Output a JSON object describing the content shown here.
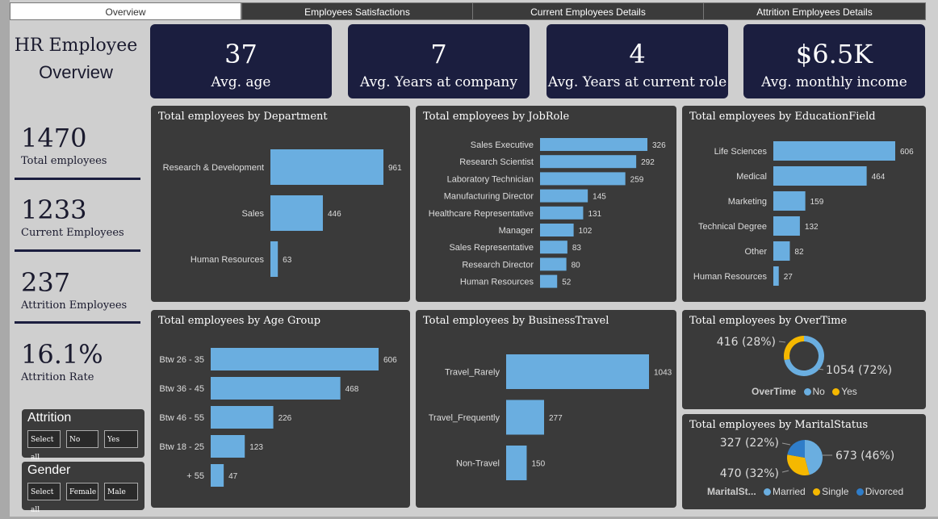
{
  "tabs": [
    {
      "label": "Overview",
      "active": true
    },
    {
      "label": "Employees Satisfactions",
      "active": false
    },
    {
      "label": "Current Employees Details",
      "active": false
    },
    {
      "label": "Attrition Employees Details",
      "active": false
    }
  ],
  "title": {
    "line1": "HR Employee",
    "line2": "Overview"
  },
  "kpis": [
    {
      "value": "37",
      "label": "Avg. age"
    },
    {
      "value": "7",
      "label": "Avg. Years at company"
    },
    {
      "value": "4",
      "label": "Avg. Years at current role"
    },
    {
      "value": "$6.5K",
      "label": "Avg. monthly income"
    }
  ],
  "stats": [
    {
      "value": "1470",
      "label": "Total employees"
    },
    {
      "value": "1233",
      "label": "Current Employees"
    },
    {
      "value": "237",
      "label": "Attrition Employees"
    },
    {
      "value": "16.1%",
      "label": "Attrition Rate"
    }
  ],
  "slicers": [
    {
      "title": "Attrition",
      "options": [
        "Select all",
        "No",
        "Yes"
      ]
    },
    {
      "title": "Gender",
      "options": [
        "Select all",
        "Female",
        "Male"
      ]
    }
  ],
  "colors": {
    "bar": "#6aaee0",
    "kpi_bg": "#1b1e3f",
    "panel_bg": "#3a3a3a",
    "no": "#6aaee0",
    "yes": "#f5b800",
    "married": "#6aaee0",
    "single": "#f5b800",
    "divorced": "#2f7dc9"
  },
  "chart_data": [
    {
      "id": "department",
      "type": "bar",
      "orientation": "horizontal",
      "title": "Total employees by Department",
      "categories": [
        "Research & Development",
        "Sales",
        "Human Resources"
      ],
      "values": [
        961,
        446,
        63
      ]
    },
    {
      "id": "jobrole",
      "type": "bar",
      "orientation": "horizontal",
      "title": "Total employees by JobRole",
      "categories": [
        "Sales Executive",
        "Research Scientist",
        "Laboratory Technician",
        "Manufacturing Director",
        "Healthcare Representative",
        "Manager",
        "Sales Representative",
        "Research Director",
        "Human Resources"
      ],
      "values": [
        326,
        292,
        259,
        145,
        131,
        102,
        83,
        80,
        52
      ]
    },
    {
      "id": "education",
      "type": "bar",
      "orientation": "horizontal",
      "title": "Total employees by EducationField",
      "categories": [
        "Life Sciences",
        "Medical",
        "Marketing",
        "Technical Degree",
        "Other",
        "Human Resources"
      ],
      "values": [
        606,
        464,
        159,
        132,
        82,
        27
      ]
    },
    {
      "id": "agegroup",
      "type": "bar",
      "orientation": "horizontal",
      "title": "Total employees by Age Group",
      "categories": [
        "Btw 26 - 35",
        "Btw 36 - 45",
        "Btw 46 - 55",
        "Btw 18 - 25",
        "+ 55"
      ],
      "values": [
        606,
        468,
        226,
        123,
        47
      ]
    },
    {
      "id": "travel",
      "type": "bar",
      "orientation": "horizontal",
      "title": "Total employees by BusinessTravel",
      "categories": [
        "Travel_Rarely",
        "Travel_Frequently",
        "Non-Travel"
      ],
      "values": [
        1043,
        277,
        150
      ]
    },
    {
      "id": "overtime",
      "type": "pie",
      "donut": true,
      "title": "Total employees by OverTime",
      "legend_title": "OverTime",
      "slices": [
        {
          "name": "No",
          "value": 1054,
          "label": "1054 (72%)"
        },
        {
          "name": "Yes",
          "value": 416,
          "label": "416 (28%)"
        }
      ]
    },
    {
      "id": "marital",
      "type": "pie",
      "donut": false,
      "title": "Total employees by MaritalStatus",
      "legend_title": "MaritalSt...",
      "slices": [
        {
          "name": "Married",
          "value": 673,
          "label": "673 (46%)"
        },
        {
          "name": "Single",
          "value": 470,
          "label": "470 (32%)"
        },
        {
          "name": "Divorced",
          "value": 327,
          "label": "327 (22%)"
        }
      ]
    }
  ]
}
